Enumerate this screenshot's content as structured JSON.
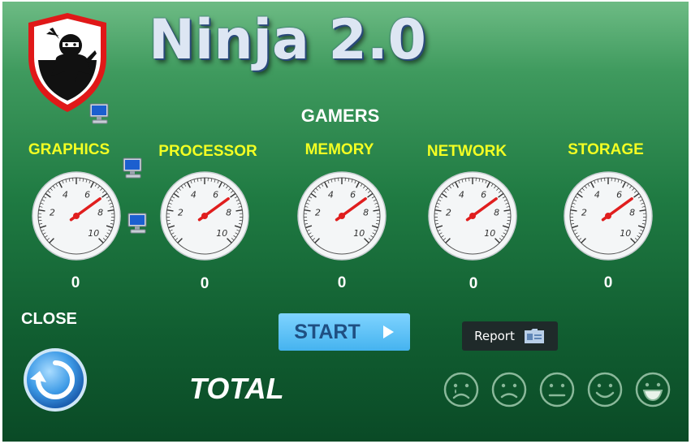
{
  "app": {
    "title": "Ninja 2.0",
    "subtitle": "GAMERS",
    "logo_icon": "ninja-shield-logo",
    "accent_yellow": "#f3ff23",
    "shield_red": "#e01818"
  },
  "gauges": [
    {
      "label": "GRAPHICS",
      "value": "0"
    },
    {
      "label": "PROCESSOR",
      "value": "0"
    },
    {
      "label": "MEMORY",
      "value": "0"
    },
    {
      "label": "NETWORK",
      "value": "0"
    },
    {
      "label": "STORAGE",
      "value": "0"
    }
  ],
  "gauge_scale": {
    "ticks": [
      "2",
      "4",
      "6",
      "8",
      "10"
    ]
  },
  "controls": {
    "close_label": "CLOSE",
    "close_icon": "refresh-circle-icon",
    "start_label": "START",
    "start_icon": "play-arrow-icon",
    "report_label": "Report",
    "report_icon": "id-card-icon",
    "total_label": "TOTAL"
  },
  "rating_faces": [
    "crying-face-icon",
    "sad-face-icon",
    "neutral-face-icon",
    "smile-face-icon",
    "grin-face-icon"
  ]
}
